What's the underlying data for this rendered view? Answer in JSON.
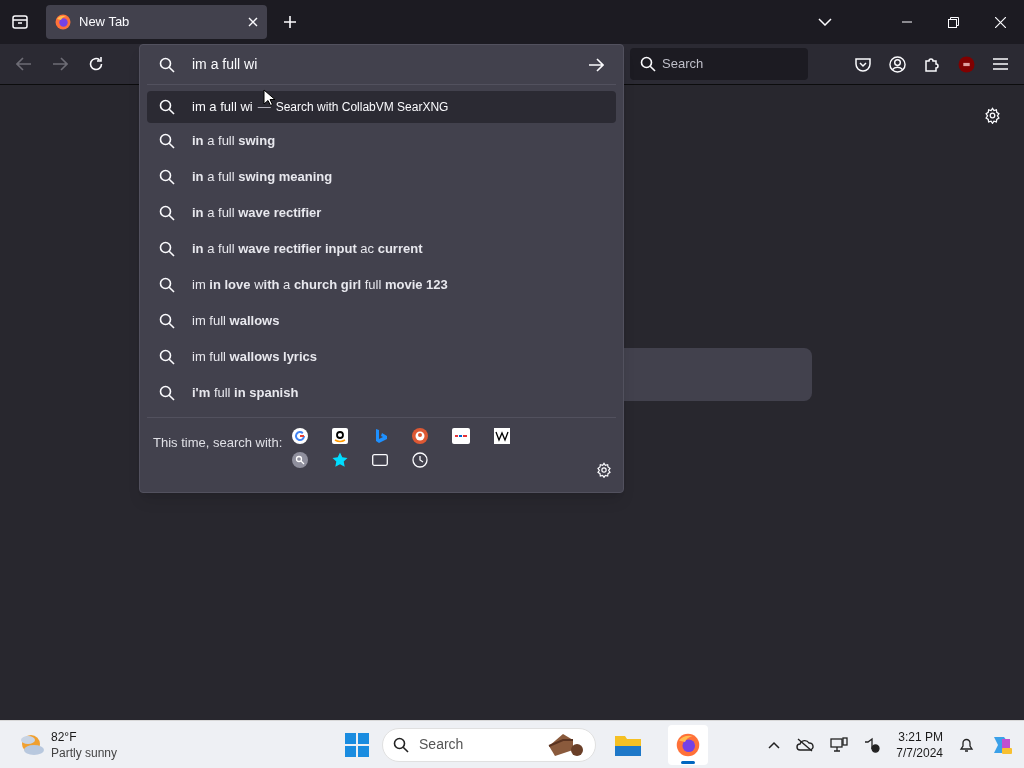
{
  "tabs": [
    {
      "title": "New Tab",
      "selected": true
    }
  ],
  "toolbar": {
    "search": {
      "placeholder": "Search"
    }
  },
  "address_bar": {
    "value": "im a full wi"
  },
  "heuristic_result": {
    "query": "im a full wi",
    "separator": "—",
    "action": "Search with CollabVM SearXNG",
    "selected": true
  },
  "suggestions": [
    {
      "text": "**in** a full **swing**",
      "selected": false
    },
    {
      "text": "**in** a full **swing meaning**",
      "selected": false
    },
    {
      "text": "**in** a full **wave rectifier**",
      "selected": false
    },
    {
      "text": "**in** a full **wave rectifier input** ac **current**",
      "selected": false
    },
    {
      "text": "im **in love** w**ith** a **church girl** full **movie 123**",
      "selected": false
    },
    {
      "text": "im full **wallows**",
      "selected": false
    },
    {
      "text": "im full **wallows lyrics**",
      "selected": false
    },
    {
      "text": "**i'm** full **in spanish**",
      "selected": false
    }
  ],
  "search_with": {
    "label": "This time, search with:"
  },
  "taskbar": {
    "weather": {
      "temperature": "82°F",
      "condition": "Partly sunny"
    },
    "search": {
      "placeholder": "Search"
    },
    "time": "3:21 PM",
    "date": "7/7/2024",
    "apps": [
      {
        "kind": "explorer",
        "selected": false
      },
      {
        "kind": "firefox",
        "selected": true
      }
    ]
  }
}
